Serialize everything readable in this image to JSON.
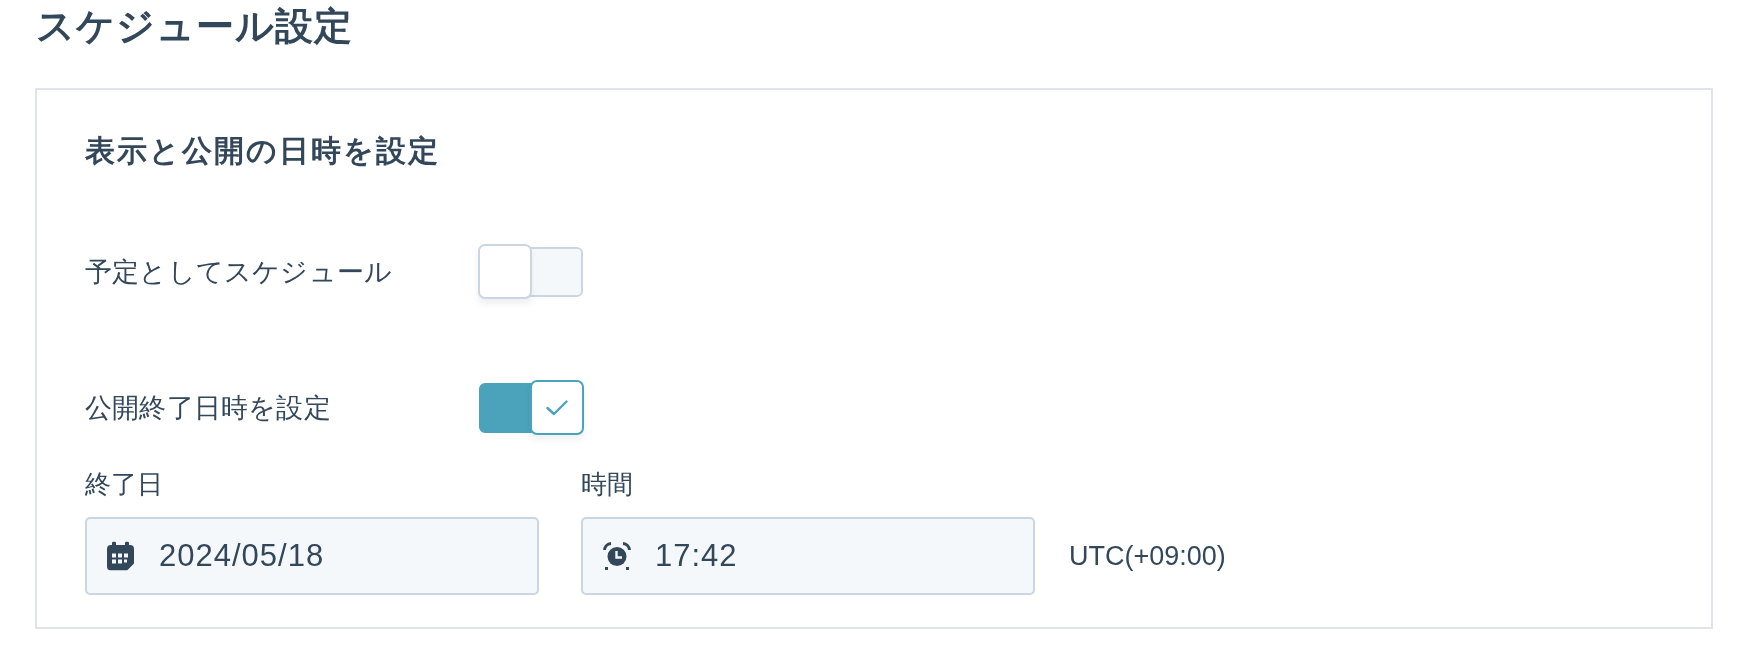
{
  "page": {
    "title": "スケジュール設定"
  },
  "card": {
    "heading": "表示と公開の日時を設定",
    "toggles": [
      {
        "label": "予定としてスケジュール",
        "on": false
      },
      {
        "label": "公開終了日時を設定",
        "on": true
      }
    ],
    "fields": [
      {
        "kind": "date",
        "label": "終了日",
        "value": "2024/05/18"
      },
      {
        "kind": "time",
        "label": "時間",
        "value": "17:42"
      }
    ],
    "timezone": "UTC(+09:00)"
  }
}
